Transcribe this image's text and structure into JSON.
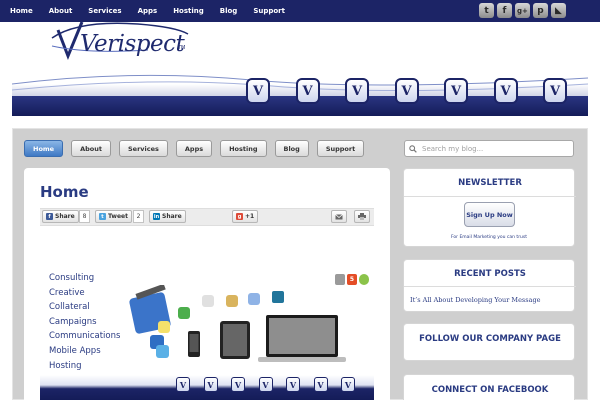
{
  "top_nav": {
    "items": [
      "Home",
      "About",
      "Services",
      "Apps",
      "Hosting",
      "Blog",
      "Support"
    ]
  },
  "social": [
    {
      "icon": "twitter-icon",
      "glyph": "t"
    },
    {
      "icon": "facebook-icon",
      "glyph": "f"
    },
    {
      "icon": "googleplus-icon",
      "glyph": "g+"
    },
    {
      "icon": "pinterest-icon",
      "glyph": "p"
    },
    {
      "icon": "rss-icon",
      "glyph": "◣"
    }
  ],
  "logo": {
    "text": "Verispect",
    "tm": "TM"
  },
  "header_icons": [
    "V",
    "V",
    "V",
    "V",
    "V",
    "V",
    "V"
  ],
  "main_nav": {
    "items": [
      "Home",
      "About",
      "Services",
      "Apps",
      "Hosting",
      "Blog",
      "Support"
    ],
    "active": "Home"
  },
  "search": {
    "placeholder": "Search my blog..."
  },
  "page": {
    "title": "Home",
    "share": {
      "facebook": {
        "label": "Share",
        "count": "8"
      },
      "twitter": {
        "label": "Tweet",
        "count": "2"
      },
      "linkedin": {
        "label": "Share"
      },
      "gplus": {
        "label": "+1"
      }
    },
    "services": [
      "Consulting",
      "Creative",
      "Collateral",
      "Campaigns",
      "Communications",
      "Mobile Apps",
      "Hosting"
    ]
  },
  "sidebar": {
    "newsletter": {
      "title": "NEWSLETTER",
      "button": "Sign Up Now",
      "note": "For Email Marketing you can trust"
    },
    "recent_posts": {
      "title": "RECENT POSTS",
      "items": [
        "It’s All About Developing Your Message"
      ]
    },
    "company_page": {
      "title": "FOLLOW OUR COMPANY PAGE"
    },
    "facebook": {
      "title": "CONNECT ON FACEBOOK"
    }
  },
  "colors": {
    "brand_navy": "#1c2466",
    "title_blue": "#2a3b82",
    "active_pill": "#3f79c4"
  }
}
